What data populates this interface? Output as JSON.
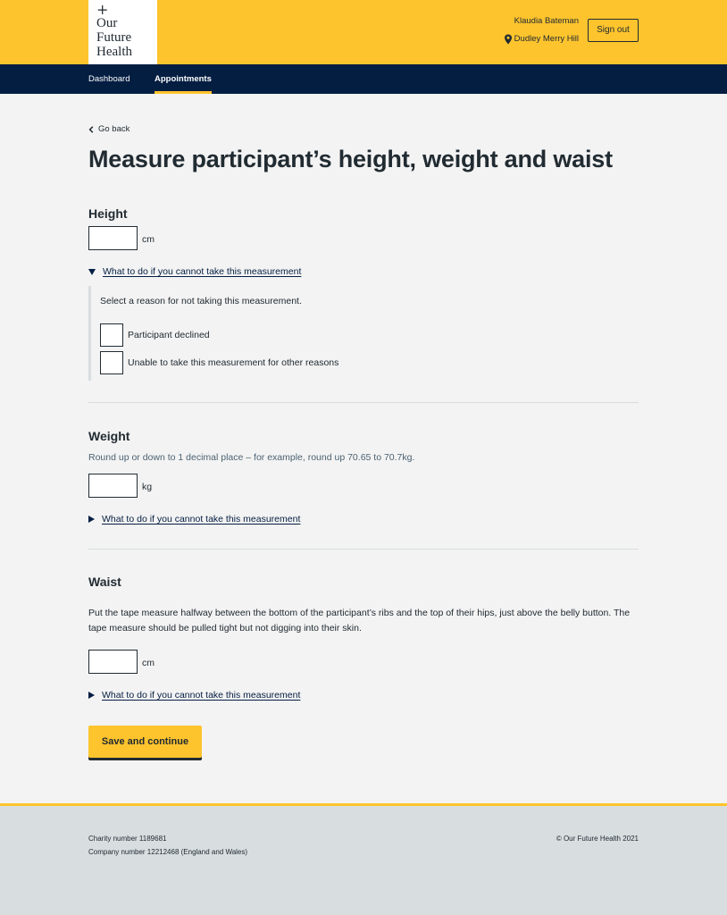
{
  "header": {
    "logo": {
      "plus": "+",
      "line1": "Our",
      "line2": "Future",
      "line3": "Health"
    },
    "user_name": "Klaudia Bateman",
    "location": "Dudley Merry Hill",
    "sign_out_label": "Sign out"
  },
  "nav": {
    "items": [
      {
        "label": "Dashboard",
        "active": false
      },
      {
        "label": "Appointments",
        "active": true
      }
    ]
  },
  "page": {
    "back_label": "Go back",
    "title": "Measure participant’s height, weight and waist",
    "height": {
      "label": "Height",
      "value": "",
      "unit": "cm",
      "details_summary": "What to do if you cannot take this measurement",
      "details_open": true,
      "reveal_prompt": "Select a reason for not taking this measurement.",
      "options": [
        {
          "label": "Participant declined",
          "checked": false
        },
        {
          "label": "Unable to take this measurement for other reasons",
          "checked": false
        }
      ]
    },
    "weight": {
      "label": "Weight",
      "hint": "Round up or down to 1 decimal place – for example, round up 70.65 to 70.7kg.",
      "value": "",
      "unit": "kg",
      "details_summary": "What to do if you cannot take this measurement",
      "details_open": false
    },
    "waist": {
      "label": "Waist",
      "instructions": "Put the tape measure halfway between the bottom of the participant’s ribs and the top of their hips, just above the belly button. The tape measure should be pulled tight but not digging into their skin.",
      "value": "",
      "unit": "cm",
      "details_summary": "What to do if you cannot take this measurement",
      "details_open": false
    },
    "submit_label": "Save and continue"
  },
  "footer": {
    "charity": "Charity number 1189681",
    "company": "Company number 12212468 (England and Wales)",
    "copyright": "© Our Future Health 2021"
  },
  "colors": {
    "brand_yellow": "#fec42d",
    "nav_navy": "#041e42",
    "text": "#212b32",
    "page_bg": "#f3f3f3",
    "footer_bg": "#d8dde0"
  },
  "icons": {
    "logo": "plus-icon",
    "location": "map-pin-icon",
    "back": "chevron-left-icon",
    "details_open": "triangle-down-icon",
    "details_closed": "triangle-right-icon"
  }
}
